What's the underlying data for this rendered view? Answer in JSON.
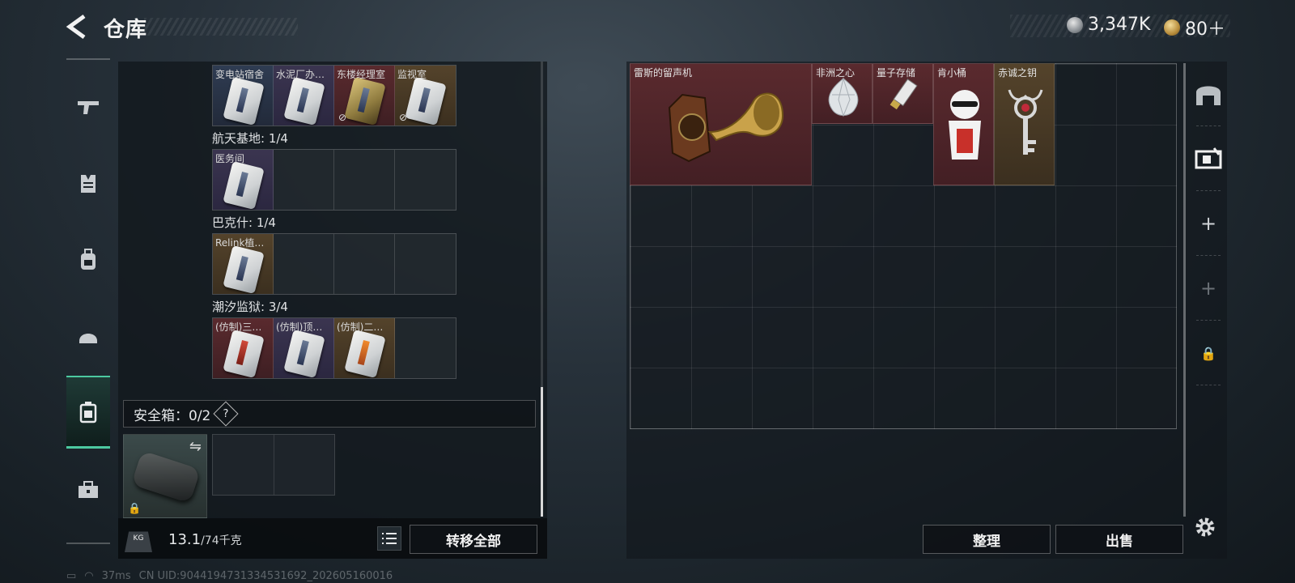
{
  "header": {
    "title": "仓库",
    "currencies": [
      {
        "icon": "silver-coin-icon",
        "value": "3,347K"
      },
      {
        "icon": "gold-coin-icon",
        "value": "80＋"
      }
    ]
  },
  "rail": {
    "items": [
      {
        "name": "weapons",
        "icon": "gun-icon"
      },
      {
        "name": "armor",
        "icon": "vest-icon"
      },
      {
        "name": "backpacks",
        "icon": "backpack-icon"
      },
      {
        "name": "helmets",
        "icon": "helmet-icon"
      },
      {
        "name": "keycards",
        "icon": "keycard-case-icon",
        "active": true
      },
      {
        "name": "containers",
        "icon": "toolbox-icon"
      }
    ]
  },
  "keycard_groups": [
    {
      "label": "",
      "cells": [
        {
          "name": "变电站宿舍",
          "tint": "blue",
          "nosell": false
        },
        {
          "name": "水泥厂办…",
          "tint": "purple",
          "nosell": false
        },
        {
          "name": "东楼经理室",
          "tint": "red",
          "nosell": true,
          "card": "gold"
        },
        {
          "name": "监视室",
          "tint": "gold",
          "nosell": true
        }
      ]
    },
    {
      "label": "航天基地: 1/4",
      "cells": [
        {
          "name": "医务间",
          "tint": "purple"
        },
        {
          "name": ""
        },
        {
          "name": ""
        },
        {
          "name": ""
        }
      ]
    },
    {
      "label": "巴克什: 1/4",
      "cells": [
        {
          "name": "Relink植…",
          "tint": "gold"
        },
        {
          "name": ""
        },
        {
          "name": ""
        },
        {
          "name": ""
        }
      ]
    },
    {
      "label": "潮汐监狱: 3/4",
      "cells": [
        {
          "name": "(仿制)三…",
          "tint": "red",
          "card": "red"
        },
        {
          "name": "(仿制)顶…",
          "tint": "purple"
        },
        {
          "name": "(仿制)二…",
          "tint": "gold",
          "card": "orange"
        },
        {
          "name": ""
        }
      ]
    }
  ],
  "safe_box": {
    "label": "安全箱：0/2",
    "help": "?"
  },
  "bottom": {
    "weight_icon": "KG",
    "weight_current": "13.1",
    "weight_max": "/74千克",
    "transfer_all": "转移全部",
    "organize": "整理",
    "sell": "出售"
  },
  "stash_items": [
    {
      "name": "雷斯的留声机",
      "tint": "red",
      "icon": "gramophone-icon"
    },
    {
      "name": "非洲之心",
      "tint": "red",
      "icon": "diamond-icon"
    },
    {
      "name": "量子存储",
      "tint": "red",
      "icon": "usb-drive-icon"
    },
    {
      "name": "肯小桶",
      "tint": "red",
      "icon": "bucket-figure-icon"
    },
    {
      "name": "赤诚之钥",
      "tint": "gold",
      "icon": "ornate-key-icon"
    }
  ],
  "side_rail": [
    "stash-tab-icon",
    "safe-tab-icon",
    "plus-icon",
    "plus-icon",
    "lock-icon"
  ],
  "status": {
    "ping": "37ms",
    "uid": "CN UID:9044194731334531692_202605160016"
  },
  "colors": {
    "accent": "#4cc9a0",
    "red_tier": "#5a2a2e",
    "gold_tier": "#54432b"
  }
}
